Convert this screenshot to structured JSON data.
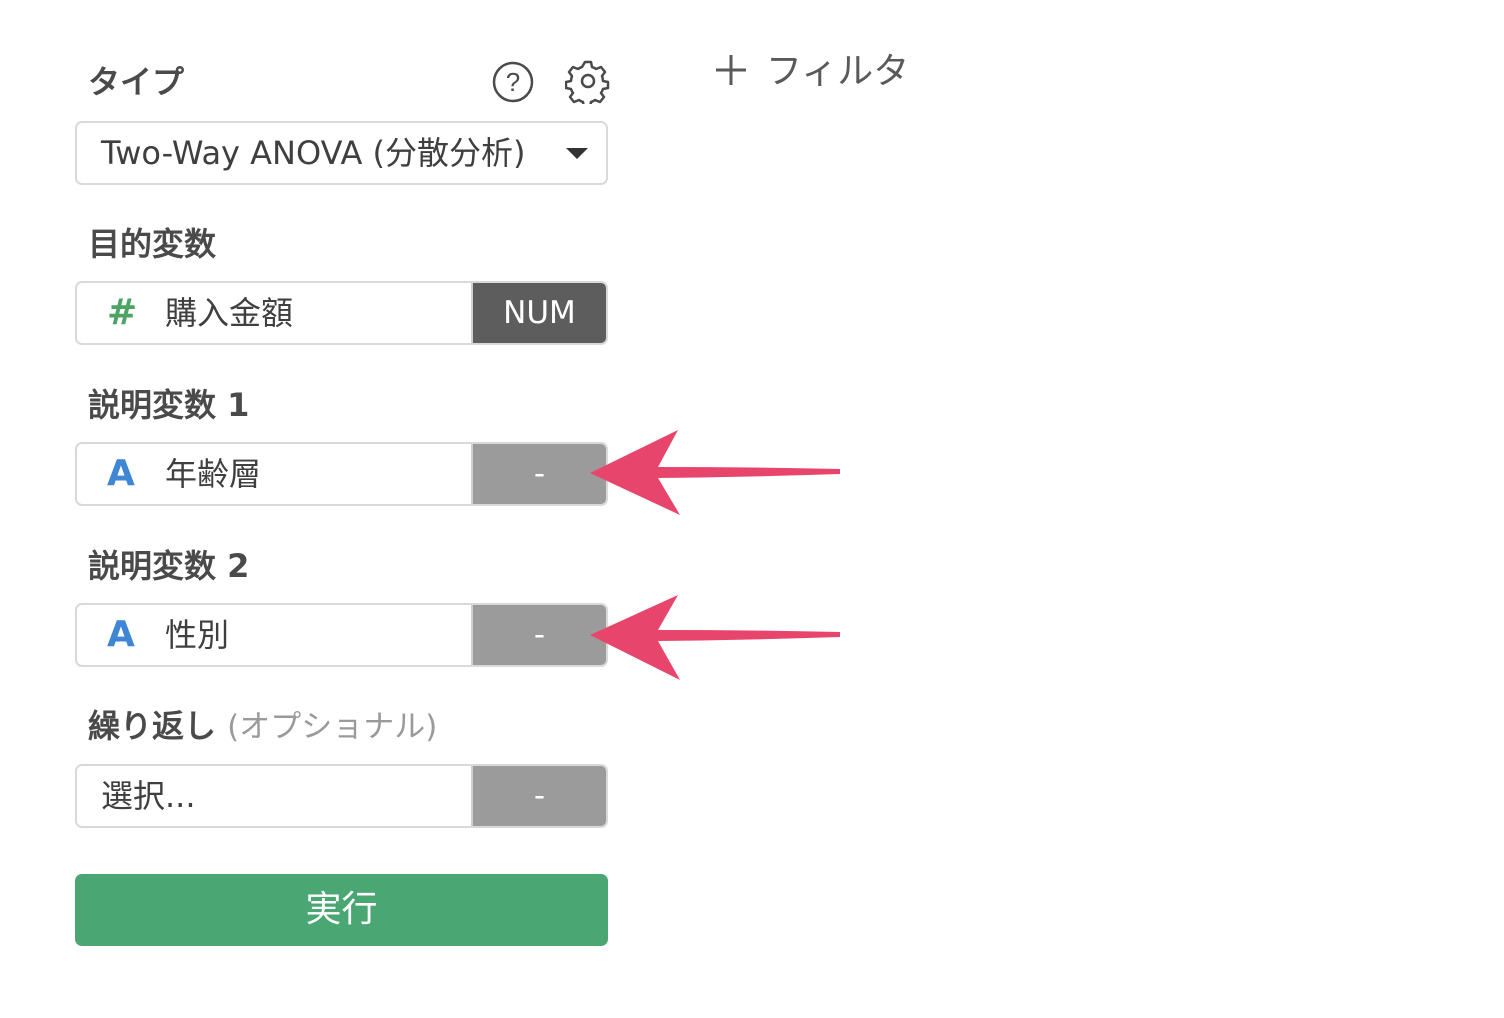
{
  "type_section": {
    "label": "タイプ",
    "help_icon": "question-circle-icon",
    "settings_icon": "gear-icon",
    "dropdown_value": "Two-Way ANOVA (分散分析)",
    "dropdown_icon": "caret-down-icon"
  },
  "filter": {
    "plus_icon": "plus-icon",
    "label": "フィルタ"
  },
  "target_variable": {
    "label": "目的変数",
    "type_icon": "#",
    "value": "購入金額",
    "side_label": "NUM"
  },
  "explanatory_1": {
    "label": "説明変数 1",
    "type_icon": "A",
    "value": "年齢層",
    "side_label": "-"
  },
  "explanatory_2": {
    "label": "説明変数 2",
    "type_icon": "A",
    "value": "性別",
    "side_label": "-"
  },
  "repeat": {
    "label": "繰り返し",
    "optional": "(オプショナル)",
    "placeholder": "選択...",
    "side_label": "-"
  },
  "run_button": {
    "label": "実行",
    "color": "#4aa672"
  },
  "annotation": {
    "arrow_color": "#e8456d"
  }
}
